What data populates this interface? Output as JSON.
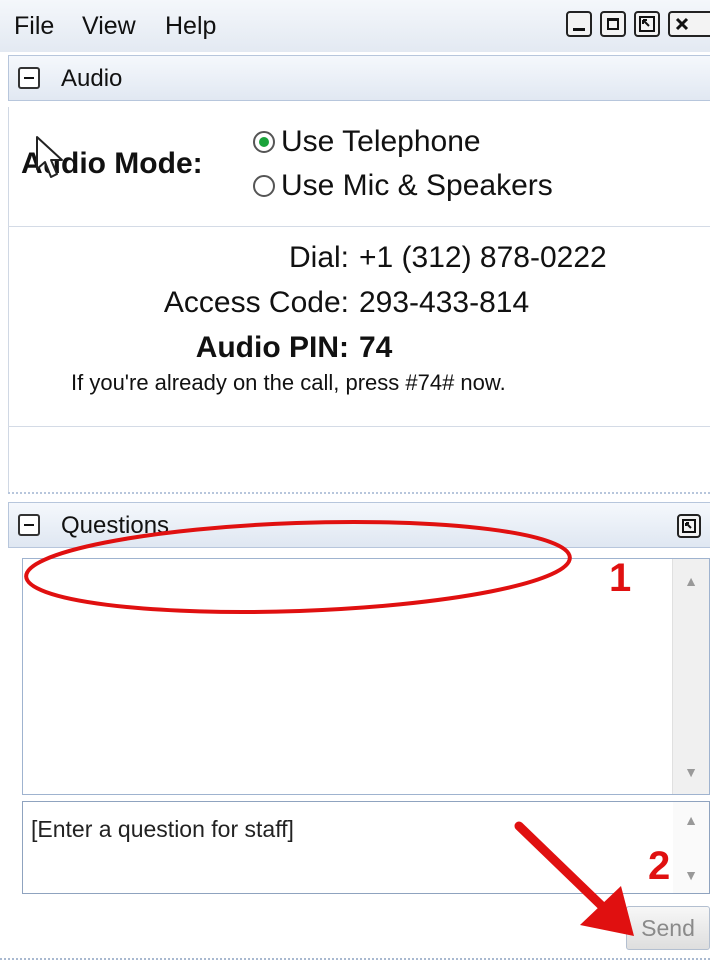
{
  "menubar": {
    "items": [
      "File",
      "View",
      "Help"
    ],
    "window_buttons": [
      "minimize-icon",
      "maximize-icon",
      "restore-icon",
      "close-icon"
    ]
  },
  "audio_panel": {
    "title": "Audio",
    "mode_label": "Audio Mode:",
    "options": [
      {
        "label": "Use Telephone",
        "selected": true
      },
      {
        "label": "Use Mic & Speakers",
        "selected": false
      }
    ],
    "dial_label": "Dial:",
    "dial_value": "+1 (312) 878-0222",
    "access_label": "Access Code:",
    "access_value": "293-433-814",
    "pin_label": "Audio PIN:",
    "pin_value": "74",
    "note": "If you're already on the call, press #74# now."
  },
  "questions_panel": {
    "title": "Questions",
    "input_placeholder": "[Enter a question for staff]",
    "send_label": "Send"
  },
  "annotations": {
    "one": "1",
    "two": "2"
  },
  "colors": {
    "accent_green": "#1aa33a",
    "annotation_red": "#e01010",
    "header_border": "#b7c6dc"
  }
}
